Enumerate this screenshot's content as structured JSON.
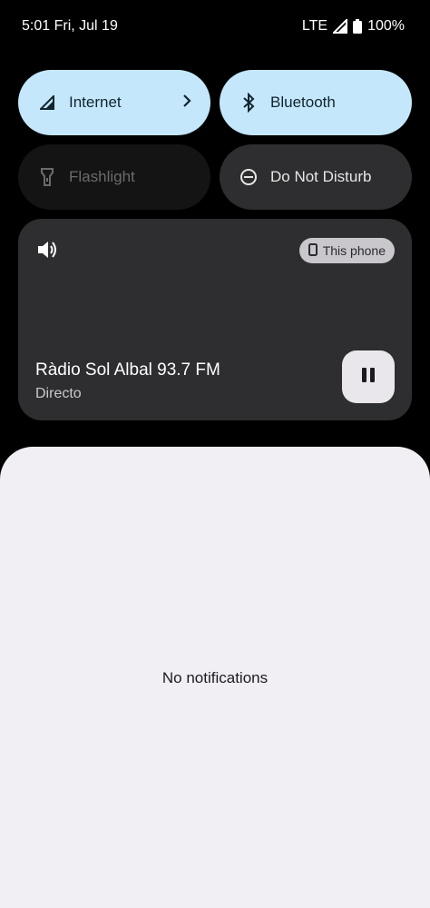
{
  "status_bar": {
    "time": "5:01",
    "date": "Fri, Jul 19",
    "network": "LTE",
    "battery": "100%"
  },
  "tiles": {
    "internet": {
      "label": "Internet",
      "state": "on",
      "icon": "signal-icon"
    },
    "bluetooth": {
      "label": "Bluetooth",
      "state": "on",
      "icon": "bluetooth-icon"
    },
    "flashlight": {
      "label": "Flashlight",
      "state": "unavailable",
      "icon": "flashlight-icon"
    },
    "dnd": {
      "label": "Do Not Disturb",
      "state": "off",
      "icon": "do-not-disturb-icon"
    }
  },
  "media": {
    "output_device": "This phone",
    "title": "Ràdio Sol Albal 93.7 FM",
    "subtitle": "Directo",
    "playback_state": "playing"
  },
  "notifications": {
    "empty_text": "No notifications"
  },
  "colors": {
    "tile_active": "#c4e7fb",
    "tile_inactive": "#2e2e30",
    "media_card": "#2e2d30",
    "panel_bg": "#f1eff3"
  }
}
